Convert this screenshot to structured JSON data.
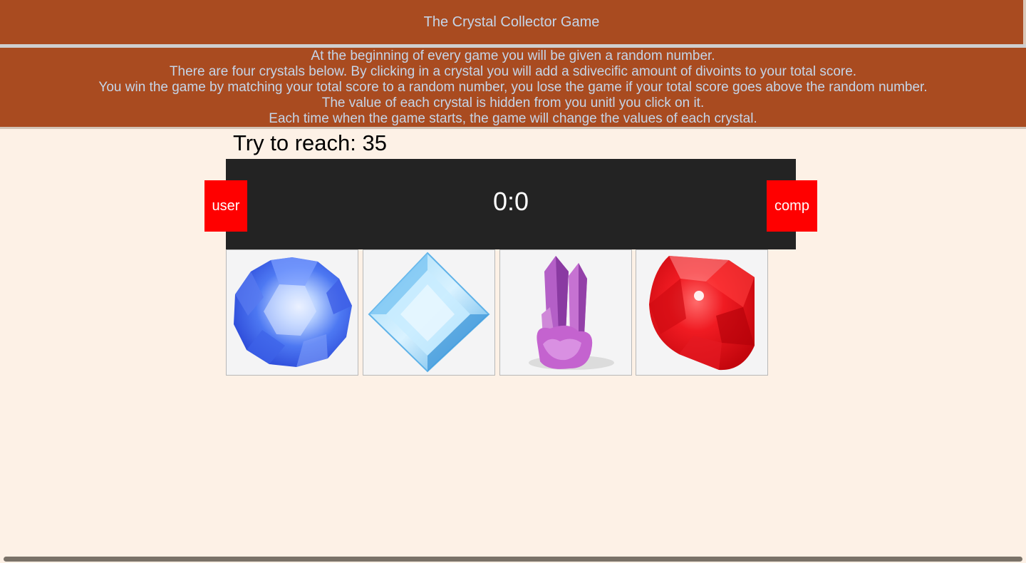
{
  "header": {
    "title": "The Crystal Collector Game"
  },
  "instructions": [
    "At the beginning of every game you will be given a random number.",
    "There are four crystals below. By clicking in a crystal you will add a sdivecific amount of divoints to your total score.",
    "You win the game by matching your total score to a random number, you lose the game if your total score goes above the random number.",
    "The value of each crystal is hidden from you unitl you click on it.",
    "Each time when the game starts, the game will change the values of each crystal."
  ],
  "target": {
    "text": "Try to reach: 35"
  },
  "scoreboard": {
    "score": "0:0",
    "user_label": "user",
    "comp_label": "comp"
  },
  "crystals": [
    {
      "icon": "blue-round-gem-icon",
      "color": "#3b6cf0"
    },
    {
      "icon": "light-blue-diamond-gem-icon",
      "color": "#6ec3f2"
    },
    {
      "icon": "purple-crystal-cluster-icon",
      "color": "#b04fc0"
    },
    {
      "icon": "red-ruby-gem-icon",
      "color": "#e8101a"
    }
  ],
  "colors": {
    "header_bg": "#a94b20",
    "header_text": "#c5d5e8",
    "page_bg": "#fdf1e6",
    "scoreboard_bg": "#232323",
    "player_btn": "#ff0000"
  }
}
